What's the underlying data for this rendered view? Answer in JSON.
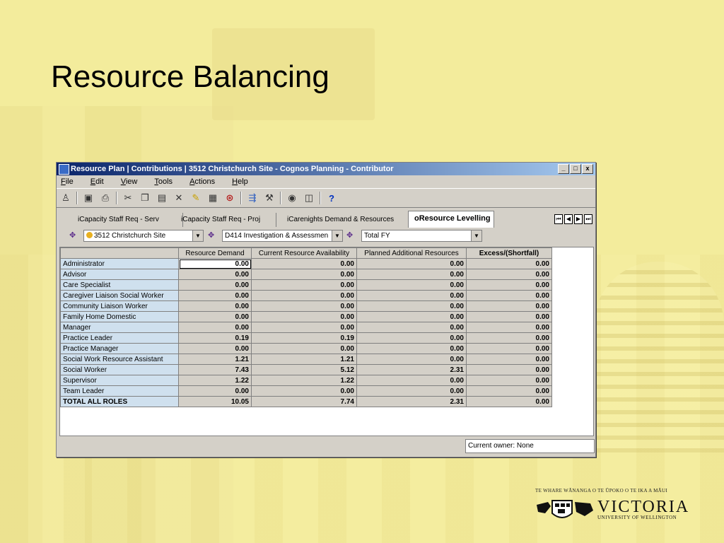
{
  "slide": {
    "title": "Resource Balancing"
  },
  "window": {
    "title": "Resource Plan | Contributions | 3512 Christchurch Site - Cognos Planning - Contributor",
    "buttons": [
      "_",
      "□",
      "x"
    ]
  },
  "menu": [
    "File",
    "Edit",
    "View",
    "Tools",
    "Actions",
    "Help"
  ],
  "toolbar": [
    "tool-icon",
    "save-icon",
    "print-icon",
    "cut-icon",
    "copy-icon",
    "paste-icon",
    "delete-icon",
    "annotate-icon",
    "calendar-icon",
    "history-icon",
    "import-icon",
    "tools-icon",
    "back-icon",
    "forward-icon",
    "help-icon"
  ],
  "tabs": [
    {
      "label": "iCapacity Staff Req - Serv"
    },
    {
      "label": "iCapacity Staff Req - Proj"
    },
    {
      "label": "iCarenights Demand & Resources"
    },
    {
      "label": "oResource Levelling"
    }
  ],
  "filters": {
    "site": "3512 Christchurch Site",
    "project": "D414 Investigation & Assessmen",
    "period": "Total FY"
  },
  "grid": {
    "columns": [
      "Resource Demand",
      "Current Resource Availability",
      "Planned Additional Resources",
      "Excess/(Shortfall)"
    ],
    "rows": [
      {
        "role": "Administrator",
        "values": [
          "0.00",
          "0.00",
          "0.00",
          "0.00"
        ]
      },
      {
        "role": "Advisor",
        "values": [
          "0.00",
          "0.00",
          "0.00",
          "0.00"
        ]
      },
      {
        "role": "Care Specialist",
        "values": [
          "0.00",
          "0.00",
          "0.00",
          "0.00"
        ]
      },
      {
        "role": "Caregiver Liaison Social Worker",
        "values": [
          "0.00",
          "0.00",
          "0.00",
          "0.00"
        ]
      },
      {
        "role": "Community Liaison Worker",
        "values": [
          "0.00",
          "0.00",
          "0.00",
          "0.00"
        ]
      },
      {
        "role": "Family Home Domestic",
        "values": [
          "0.00",
          "0.00",
          "0.00",
          "0.00"
        ]
      },
      {
        "role": "Manager",
        "values": [
          "0.00",
          "0.00",
          "0.00",
          "0.00"
        ]
      },
      {
        "role": "Practice Leader",
        "values": [
          "0.19",
          "0.19",
          "0.00",
          "0.00"
        ]
      },
      {
        "role": "Practice Manager",
        "values": [
          "0.00",
          "0.00",
          "0.00",
          "0.00"
        ]
      },
      {
        "role": "Social Work Resource Assistant",
        "values": [
          "1.21",
          "1.21",
          "0.00",
          "0.00"
        ]
      },
      {
        "role": "Social Worker",
        "values": [
          "7.43",
          "5.12",
          "2.31",
          "0.00"
        ]
      },
      {
        "role": "Supervisor",
        "values": [
          "1.22",
          "1.22",
          "0.00",
          "0.00"
        ]
      },
      {
        "role": "Team Leader",
        "values": [
          "0.00",
          "0.00",
          "0.00",
          "0.00"
        ]
      },
      {
        "role": "TOTAL ALL ROLES",
        "values": [
          "10.05",
          "7.74",
          "2.31",
          "0.00"
        ]
      }
    ]
  },
  "status": {
    "owner": "Current owner: None"
  },
  "logo": {
    "motto": "TE WHARE WĀNANGA O TE ŪPOKO O TE IKA A MĀUI",
    "name": "VICTORIA",
    "subtitle": "UNIVERSITY OF WELLINGTON"
  },
  "colors": {
    "titlebar": "#0a246a",
    "rowheader": "#cfe0ee",
    "slide_bg": "#f3ec9c"
  }
}
